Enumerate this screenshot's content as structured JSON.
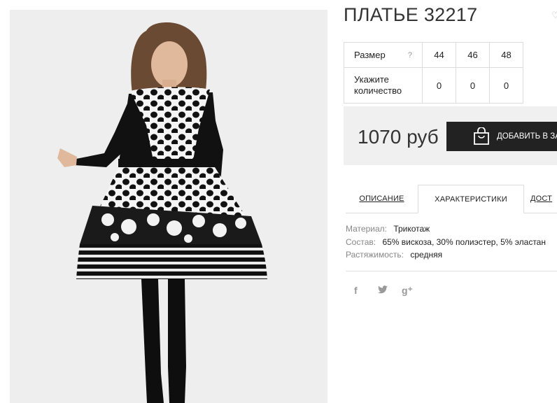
{
  "product": {
    "title": "ПЛАТЬЕ 32217",
    "image": "photo of model in black and white polka-dot long-sleeve dress"
  },
  "sizes_table": {
    "size_label": "Размер",
    "help_glyph": "?",
    "sizes": [
      "44",
      "46",
      "48"
    ],
    "quantity_label_line1": "Укажите",
    "quantity_label_line2": "количество",
    "quantities": [
      "0",
      "0",
      "0"
    ]
  },
  "purchase": {
    "price": "1070 руб",
    "add_to_cart": "ДОБАВИТЬ В ЗА"
  },
  "tabs": {
    "description": "ОПИСАНИЕ",
    "characteristics": "ХАРАКТЕРИСТИКИ",
    "delivery": "ДОСТ"
  },
  "specs": [
    {
      "key": "Материал:",
      "value": "Трикотаж"
    },
    {
      "key": "Состав:",
      "value": "65% вискоза, 30% полиэстер, 5% эластан"
    },
    {
      "key": "Растяжимость:",
      "value": "средняя"
    }
  ],
  "social": {
    "facebook": "f",
    "twitter": "🐦",
    "googleplus": "g⁺"
  },
  "colors": {
    "button_bg": "#222222",
    "price_box_bg": "#f0f0f0",
    "photo_bg": "#eeeeee"
  }
}
